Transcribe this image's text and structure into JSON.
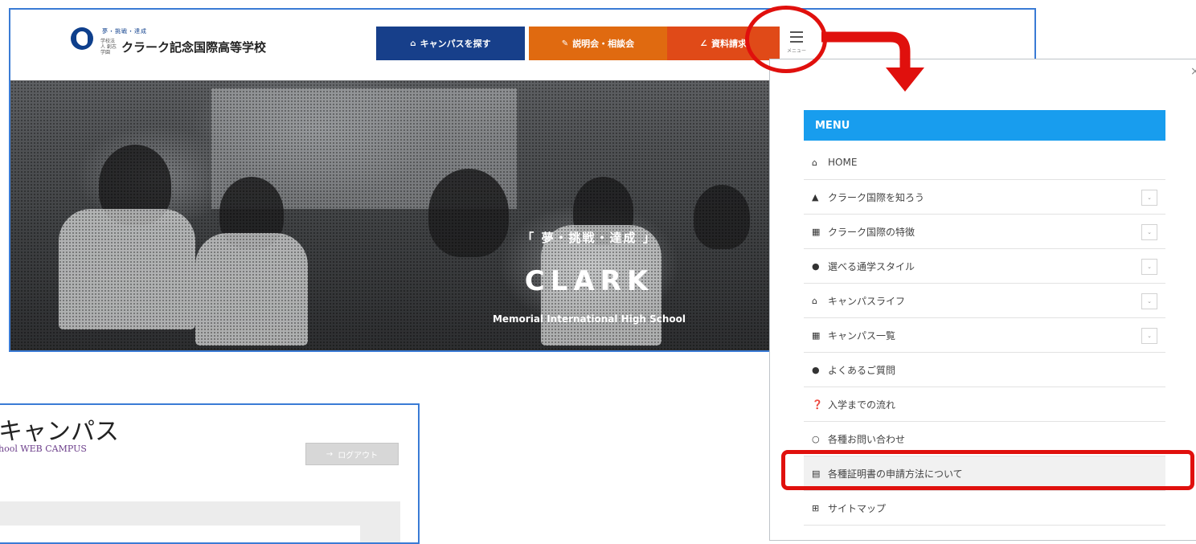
{
  "site": {
    "logo_tagline": "夢・挑戦・達成",
    "logo_corp": "学校法人 創志学園",
    "logo_name": "クラーク記念国際高等学校",
    "buttons": [
      {
        "label": "キャンパスを探す",
        "icon": "campus-icon",
        "color": "#173f8a"
      },
      {
        "label": "説明会・相談会",
        "icon": "pen-icon",
        "color": "#e06a10"
      },
      {
        "label": "資料請求",
        "icon": "pencil-icon",
        "color": "#e04a18"
      }
    ],
    "menu_button_label": "メニュー",
    "hero": {
      "tagline": "「 夢・挑戦・達成 」",
      "title": "CLARK",
      "subtitle": "Memorial International High School"
    }
  },
  "campus": {
    "title": "キャンパス",
    "subtitle": "hool  WEB CAMPUS",
    "logout_label": "ログアウト"
  },
  "menu": {
    "close_symbol": "×",
    "header": "MENU",
    "items": [
      {
        "label": "HOME",
        "icon": "home-icon",
        "glyph": "⌂",
        "expandable": false
      },
      {
        "label": "クラーク国際を知ろう",
        "icon": "graduation-cap-icon",
        "glyph": "🎓",
        "expandable": true
      },
      {
        "label": "クラーク国際の特徴",
        "icon": "building-icon",
        "glyph": "▦",
        "expandable": true
      },
      {
        "label": "選べる通学スタイル",
        "icon": "users-icon",
        "glyph": "👥",
        "expandable": true
      },
      {
        "label": "キャンパスライフ",
        "icon": "school-icon",
        "glyph": "⌂",
        "expandable": true
      },
      {
        "label": "キャンパス一覧",
        "icon": "campus-list-icon",
        "glyph": "▦",
        "expandable": true
      },
      {
        "label": "よくあるご質問",
        "icon": "comments-icon",
        "glyph": "💬",
        "expandable": false
      },
      {
        "label": "入学までの流れ",
        "icon": "question-circle-icon",
        "glyph": "?",
        "expandable": false
      },
      {
        "label": "各種お問い合わせ",
        "icon": "lightbulb-icon",
        "glyph": "○",
        "expandable": false
      },
      {
        "label": "各種証明書の申請方法について",
        "icon": "file-icon",
        "glyph": "▤",
        "expandable": false
      },
      {
        "label": "サイトマップ",
        "icon": "sitemap-icon",
        "glyph": "⊞",
        "expandable": false
      }
    ]
  },
  "colors": {
    "callout_red": "#e0100d",
    "menu_header_blue": "#189dee",
    "frame_blue": "#3a7bd5"
  }
}
